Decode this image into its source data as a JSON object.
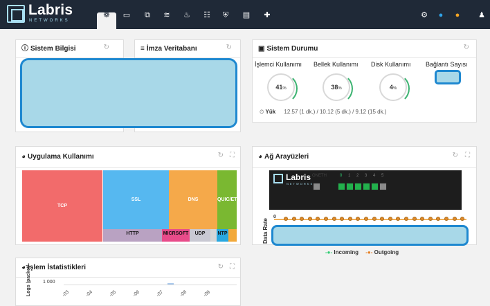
{
  "app": {
    "brand": "Labris",
    "brand_sub": "NETWORKS"
  },
  "nav": {
    "items": [
      {
        "name": "dashboard-icon",
        "glyph": "❁"
      },
      {
        "name": "monitor-icon",
        "glyph": "▭"
      },
      {
        "name": "network-icon",
        "glyph": "⧉"
      },
      {
        "name": "wifi-icon",
        "glyph": "≋"
      },
      {
        "name": "fire-icon",
        "glyph": "♨"
      },
      {
        "name": "list-icon",
        "glyph": "☷"
      },
      {
        "name": "shield-icon",
        "glyph": "⛨"
      },
      {
        "name": "clipboard-icon",
        "glyph": "▤"
      },
      {
        "name": "plus-circle-icon",
        "glyph": "✚"
      }
    ],
    "right_items": [
      {
        "name": "settings-icon",
        "glyph": "⚙"
      },
      {
        "name": "drop-icon",
        "glyph": "●"
      },
      {
        "name": "alert-icon",
        "glyph": "●"
      },
      {
        "name": "user-icon",
        "glyph": "♟"
      }
    ],
    "colors": {
      "bar": "#1f2937",
      "accent_drop": "#2fa3e8",
      "accent_alert": "#f5a623"
    }
  },
  "panels": {
    "sistem_bilgisi": {
      "title": "Sistem Bilgisi"
    },
    "imza_veritabani": {
      "title": "İmza Veritabanı"
    },
    "sistem_durumu": {
      "title": "Sistem Durumu",
      "labels": {
        "cpu": "İşlemci Kullanımı",
        "memory": "Bellek Kullanımı",
        "disk": "Disk Kullanımı",
        "connections": "Bağlantı Sayısı"
      },
      "cpu_value": "41",
      "memory_value": "38",
      "disk_value": "4",
      "percent_suffix": "%",
      "load_label": "Yük",
      "load_value": "12.57 (1 dk.) / 10.12 (5 dk.) / 9.12 (15 dk.)"
    },
    "uygulama": {
      "title": "Uygulama Kullanımı",
      "tiles": [
        {
          "label": "TCP",
          "color": "#f26b6b"
        },
        {
          "label": "SSL",
          "color": "#56b8f0"
        },
        {
          "label": "DNS",
          "color": "#f5a94a"
        },
        {
          "label": "QUIC/ETF",
          "color": "#7ab831"
        },
        {
          "label": "HTTP",
          "color": "#b9a2c2"
        },
        {
          "label": "MICRSOFT",
          "color": "#e84c8a"
        },
        {
          "label": "UDP",
          "color": "#c9c9d3"
        },
        {
          "label": "NTP",
          "color": "#29a8e0"
        }
      ]
    },
    "ag_arayuzleri": {
      "title": "Ağ Arayüzleri",
      "device_brand": "Labris",
      "device_sub": "NETWORKS",
      "port_label": "ONETH",
      "port_numbers": [
        "0",
        "1",
        "2",
        "3",
        "4",
        "5"
      ],
      "y_axis_label": "Data Rate",
      "y_tick": "0",
      "legend_in": "Incoming",
      "legend_out": "Outgoing"
    },
    "islem": {
      "title": "İşlem İstatistikleri",
      "y_axis_label": "Logs (packet/",
      "y_tick": "1 000",
      "x_ticks": [
        "-03",
        "-04",
        "-05",
        "-06",
        "-07",
        "-08",
        "-09"
      ]
    }
  }
}
